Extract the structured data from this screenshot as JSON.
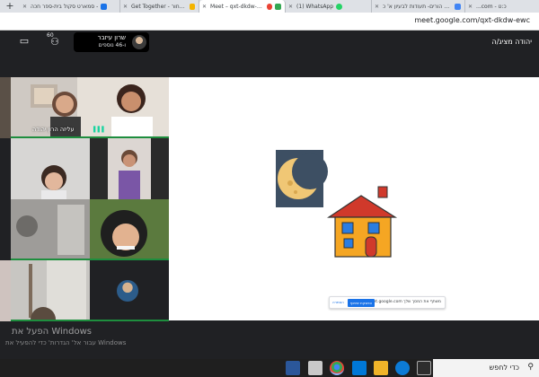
{
  "browser": {
    "tabs": [
      {
        "title": "Get Together - קראו כשחור",
        "active": false,
        "fav": "#f4b400"
      },
      {
        "title": "Meet – qxt-dkdw-ewc",
        "active": true,
        "fav": "#34a853"
      },
      {
        "title": "(1) WhatsApp",
        "active": false,
        "fav": "#25d366"
      },
      {
        "title": "יום הורים- תעודות לבעיון א' כ:",
        "active": false,
        "fav": "#4285f4"
      },
      {
        "title": "...com - כ:ט",
        "active": false,
        "fav": "#4285f4"
      }
    ],
    "left_tab": {
      "title": "סמארט סקול בית-ספר חכה -",
      "fav": "#1a73e8"
    },
    "new_tab_label": "+",
    "url": "meet.google.com/qxt-dkdw-ewc"
  },
  "meet": {
    "presenting_title": "יהודה מציג/ה",
    "presenter_name": "שרון עיזבר",
    "participants_label": "ו-46 נוספים",
    "participant_count": "60",
    "tiles": [
      {
        "label": "עליזה הרון יהודה",
        "mic": true
      },
      {
        "label": "",
        "mic": false
      },
      {
        "label": "",
        "mic": false
      },
      {
        "label": "",
        "mic": false
      },
      {
        "label": "",
        "mic": false
      },
      {
        "label": "",
        "mic": false
      },
      {
        "label": "",
        "mic": false
      },
      {
        "label": "",
        "mic": false
      },
      {
        "label": "",
        "mic": false
      }
    ],
    "share_banner": {
      "text": "meet.google.com משתף את המסך שלך",
      "stop_label": "הפסקת שיתוף",
      "hide_label": "הסתרה"
    }
  },
  "windows": {
    "activate_title": "הפעל את Windows",
    "activate_sub": "עבור אל' הגדרות' כדי להפעיל את Windows",
    "search_placeholder": "כדי לחפש"
  },
  "colors": {
    "meet_bg": "#202124",
    "accent": "#1a73e8",
    "house_wall": "#f5a623",
    "house_roof": "#d0392b",
    "window_blue": "#2a7de1",
    "moon": "#f0c775",
    "night": "#2c3e50"
  }
}
